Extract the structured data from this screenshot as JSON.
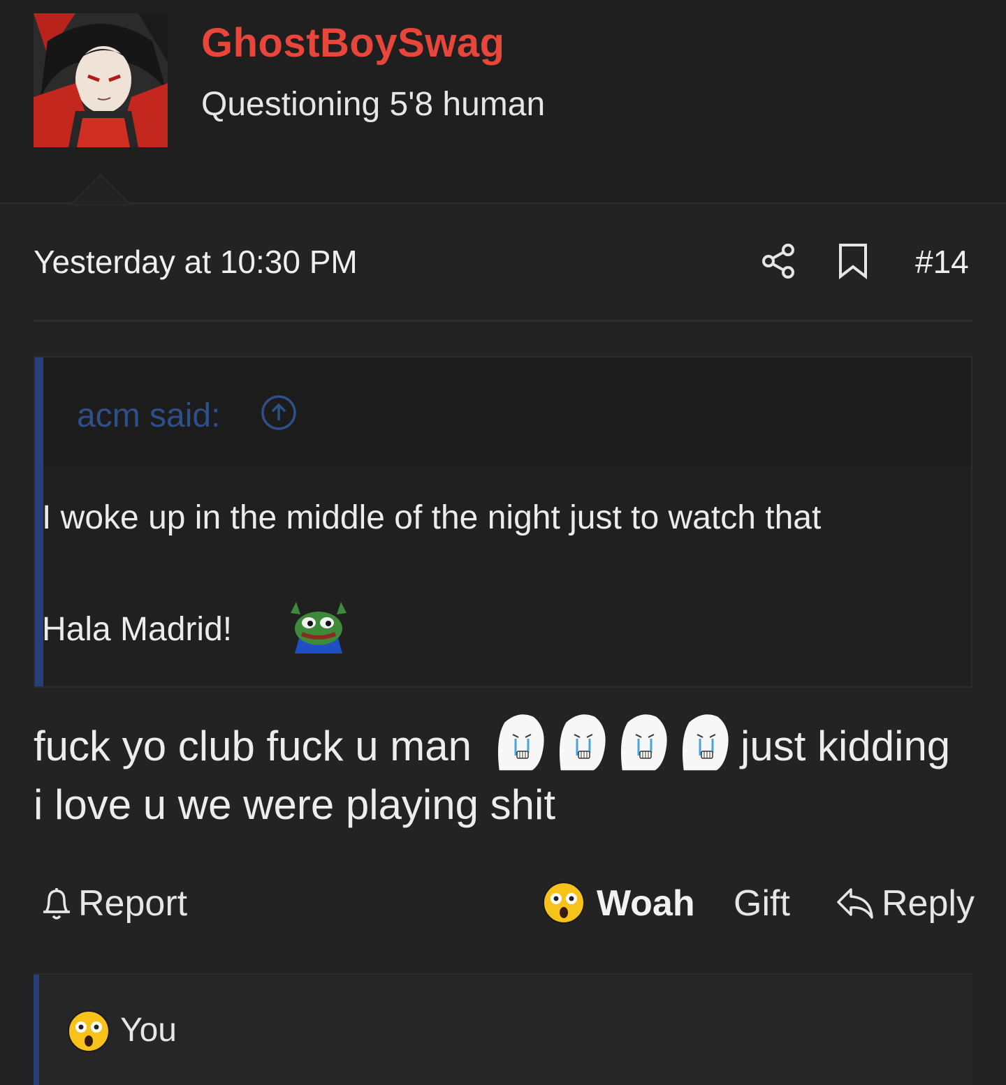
{
  "user": {
    "name": "GhostBoySwag",
    "title": "Questioning 5'8 human"
  },
  "post": {
    "date": "Yesterday at 10:30 PM",
    "number": "#14",
    "quote": {
      "author": "acm said:",
      "line1": "I woke up in the middle of the night just to watch that",
      "line2": "Hala Madrid!"
    },
    "body": {
      "line1_start": "fuck yo club fuck u man",
      "line1_end": "just kidding",
      "line2": "i love u we were playing shit"
    }
  },
  "actions": {
    "report": "Report",
    "reaction": "Woah",
    "gift": "Gift",
    "reply": "Reply"
  },
  "reactions": {
    "label": "You"
  },
  "icons": [
    "share-icon",
    "bookmark-icon",
    "arrow-up-circle-icon",
    "bell-icon",
    "reply-arrow-icon",
    "astonished-emoji",
    "pepe-emoji",
    "crying-wojak-emoji"
  ],
  "colors": {
    "username": "#e8463a",
    "quote_accent": "#25407a",
    "background": "#232323"
  }
}
